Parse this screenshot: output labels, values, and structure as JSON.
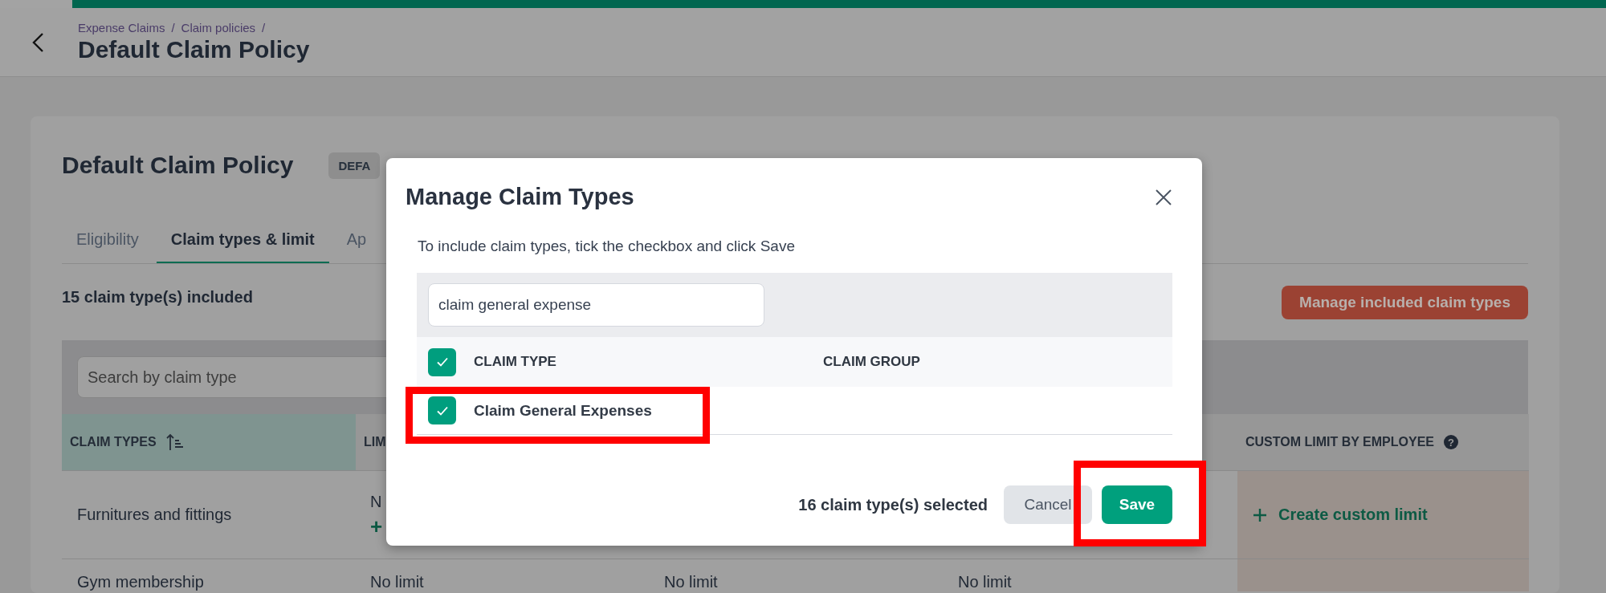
{
  "header": {
    "breadcrumbs": [
      {
        "label": "Expense Claims",
        "separator": "/"
      },
      {
        "label": "Claim policies",
        "separator": "/"
      }
    ],
    "title": "Default Claim Policy"
  },
  "policy": {
    "title": "Default Claim Policy",
    "badge": "DEFA"
  },
  "tabs": [
    {
      "label": "Eligibility",
      "selected": false
    },
    {
      "label": "Claim types & limit",
      "selected": true
    },
    {
      "label": "Ap",
      "selected": false
    }
  ],
  "included_count": "15 claim type(s) included",
  "manage_button": "Manage included claim types",
  "search": {
    "placeholder": "Search by claim type"
  },
  "table": {
    "column_1": {
      "label": "CLAIM TYPES",
      "sorted": true
    },
    "column_2": {
      "label": "LIM"
    },
    "column_5": {
      "label": "CUSTOM LIMIT BY EMPLOYEE",
      "help": "?"
    },
    "rows": [
      {
        "claim_type": "Furnitures and fittings",
        "column_2": "N",
        "column_2_icon": "+",
        "custom_limit": "Create custom limit"
      },
      {
        "claim_type": "Gym membership",
        "column_2": "No limit",
        "column_3": "No limit",
        "column_4": "No limit"
      }
    ]
  },
  "dialog": {
    "title": "Manage Claim Types",
    "instructions": "To include claim types, tick the checkbox and click Save",
    "search": {
      "value": "claim general expense"
    },
    "columns": [
      "CLAIM TYPE",
      "CLAIM GROUP"
    ],
    "select_all_checked": true,
    "rows": [
      {
        "claim_type": "Claim General Expenses",
        "checked": true
      }
    ],
    "selected_count": "16 claim type(s) selected",
    "buttons": [
      {
        "label": "Cancel",
        "kind": "secondary"
      },
      {
        "label": "Save",
        "kind": "primary"
      }
    ]
  }
}
